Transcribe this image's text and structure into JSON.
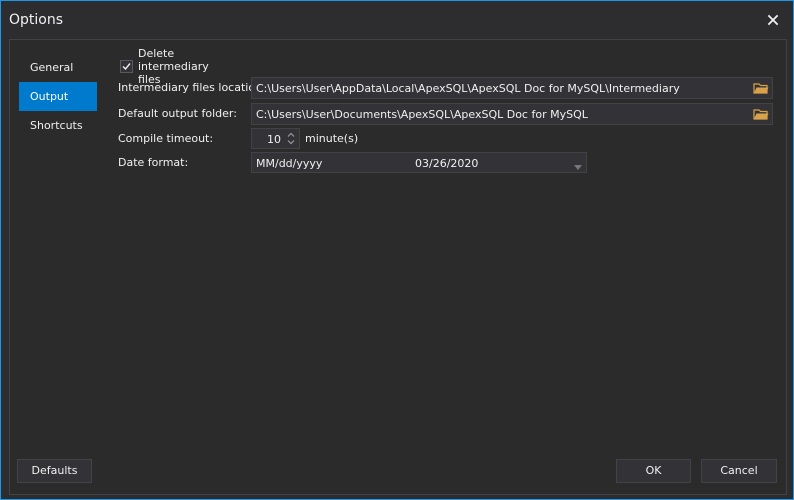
{
  "window": {
    "title": "Options"
  },
  "nav": {
    "items": [
      {
        "label": "General"
      },
      {
        "label": "Output"
      },
      {
        "label": "Shortcuts"
      }
    ],
    "active_index": 1
  },
  "output": {
    "delete_intermediary": {
      "label": "Delete intermediary files",
      "checked": true
    },
    "intermediary_location": {
      "label": "Intermediary files location:",
      "value": "C:\\Users\\User\\AppData\\Local\\ApexSQL\\ApexSQL Doc for MySQL\\Intermediary"
    },
    "default_output_folder": {
      "label": "Default output folder:",
      "value": "C:\\Users\\User\\Documents\\ApexSQL\\ApexSQL Doc for MySQL"
    },
    "compile_timeout": {
      "label": "Compile timeout:",
      "value": "10",
      "unit": "minute(s)"
    },
    "date_format": {
      "label": "Date format:",
      "value": "MM/dd/yyyy",
      "preview": "03/26/2020"
    }
  },
  "buttons": {
    "defaults": "Defaults",
    "ok": "OK",
    "cancel": "Cancel"
  },
  "colors": {
    "accent": "#007acc",
    "background": "#2d2d30",
    "folder_icon": "#d8a24a"
  }
}
